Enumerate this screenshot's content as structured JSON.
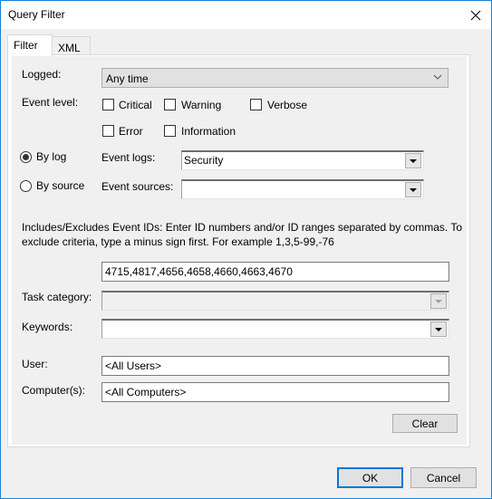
{
  "window": {
    "title": "Query Filter",
    "close_icon": "close-icon"
  },
  "tabs": [
    {
      "label": "Filter",
      "active": true
    },
    {
      "label": "XML",
      "active": false
    }
  ],
  "filter": {
    "logged": {
      "label": "Logged:",
      "value": "Any time"
    },
    "event_level": {
      "label": "Event level:",
      "options": [
        {
          "label": "Critical",
          "checked": false
        },
        {
          "label": "Warning",
          "checked": false
        },
        {
          "label": "Verbose",
          "checked": false
        },
        {
          "label": "Error",
          "checked": false
        },
        {
          "label": "Information",
          "checked": false
        }
      ]
    },
    "by_log": {
      "label": "By log",
      "selected": true
    },
    "by_source": {
      "label": "By source",
      "selected": false
    },
    "event_logs": {
      "label": "Event logs:",
      "value": "Security"
    },
    "event_sources": {
      "label": "Event sources:",
      "value": ""
    },
    "event_ids": {
      "description": "Includes/Excludes Event IDs: Enter ID numbers and/or ID ranges separated by commas. To exclude criteria, type a minus sign first. For example 1,3,5-99,-76",
      "value": "4715,4817,4656,4658,4660,4663,4670"
    },
    "task_category": {
      "label": "Task category:",
      "value": "",
      "disabled": true
    },
    "keywords": {
      "label": "Keywords:",
      "value": ""
    },
    "user": {
      "label": "User:",
      "value": "<All Users>"
    },
    "computers": {
      "label": "Computer(s):",
      "value": "<All Computers>"
    },
    "clear_label": "Clear"
  },
  "footer": {
    "ok_label": "OK",
    "cancel_label": "Cancel"
  },
  "colors": {
    "accent": "#0078d7",
    "window_border": "#1883d7"
  }
}
